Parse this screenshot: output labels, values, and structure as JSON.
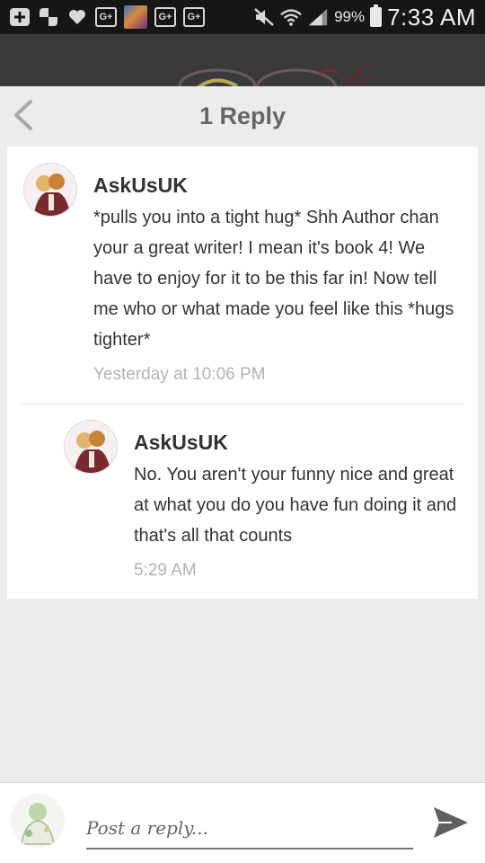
{
  "status_bar": {
    "icons_left": [
      "add-box-icon",
      "checker-icon",
      "heart-icon",
      "google-plus-icon",
      "app-thumbnail-icon",
      "google-plus-icon",
      "google-plus-icon"
    ],
    "gplus_label": "G+",
    "icons_right": [
      "mute-icon",
      "wifi-icon",
      "signal-icon",
      "battery-icon"
    ],
    "battery_percent": "99%",
    "time": "7:33 AM"
  },
  "header": {
    "title": "1 Reply",
    "back_icon": "chevron-left-icon"
  },
  "comments": [
    {
      "author": "AskUsUK",
      "text": "*pulls you into a tight hug* Shh Author chan your a great writer! I mean it's book 4! We have to enjoy for it to be this far in! Now tell me who or what made you feel like this *hugs tighter*",
      "time": "Yesterday at 10:06 PM"
    },
    {
      "author": "AskUsUK",
      "text": "No. You aren't your funny nice and great at what you do you have fun doing it and that's all that counts",
      "time": "5:29 AM"
    }
  ],
  "composer": {
    "placeholder": "Post a reply...",
    "send_icon": "send-icon"
  },
  "colors": {
    "status_bar": "#161616",
    "app_bar": "#3a3a3a",
    "background": "#ececec",
    "card": "#ffffff",
    "muted_text": "#b3b3b3"
  }
}
